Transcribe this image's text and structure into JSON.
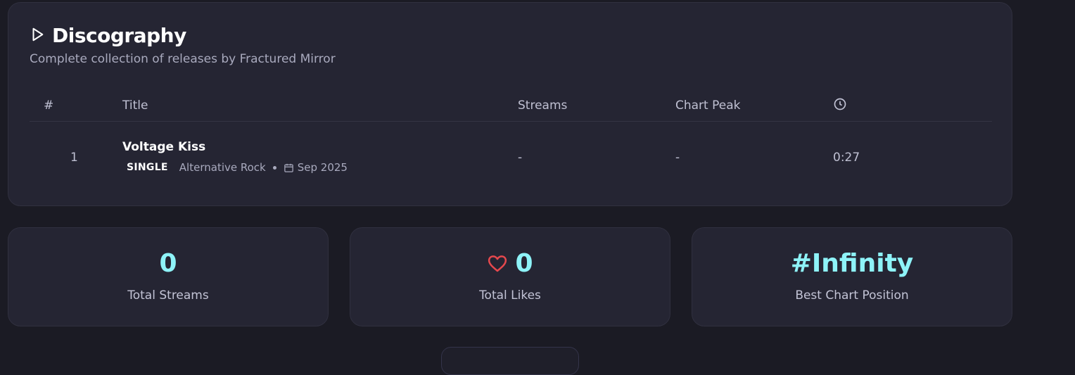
{
  "discography": {
    "title": "Discography",
    "subtitle": "Complete collection of releases by Fractured Mirror",
    "columns": {
      "number": "#",
      "title": "Title",
      "streams": "Streams",
      "chart_peak": "Chart Peak",
      "duration_icon": "clock-icon"
    },
    "rows": [
      {
        "number": "1",
        "title": "Voltage Kiss",
        "type": "SINGLE",
        "genre": "Alternative Rock",
        "date": "Sep 2025",
        "streams": "-",
        "chart_peak": "-",
        "duration": "0:27"
      }
    ]
  },
  "stats": [
    {
      "value": "0",
      "label": "Total Streams"
    },
    {
      "value": "0",
      "label": "Total Likes",
      "icon": "heart-icon"
    },
    {
      "value": "#Infinity",
      "label": "Best Chart Position"
    }
  ],
  "colors": {
    "accent": "#8ef3f8",
    "heart": "#e5484d",
    "background": "#1b1b24",
    "card": "#252533"
  }
}
